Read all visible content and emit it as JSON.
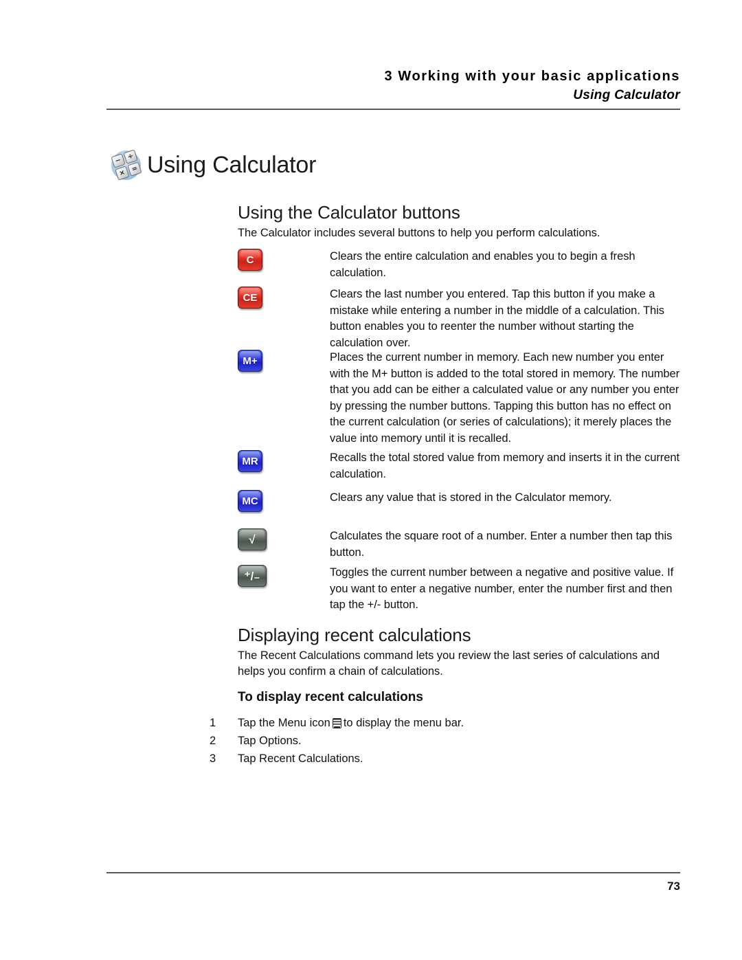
{
  "header": {
    "chapter": "3 Working with your basic applications",
    "section": "Using Calculator"
  },
  "title": {
    "text": "Using Calculator",
    "icon": "calculator-icon",
    "icon_keys": [
      "−",
      "÷",
      "×",
      "="
    ]
  },
  "section_buttons": {
    "heading": "Using the Calculator buttons",
    "intro": "The Calculator includes several buttons to help you perform calculations.",
    "rows": [
      {
        "key_label": "C",
        "key_name": "clear-button",
        "key_color": "#e32b20",
        "description": "Clears the entire calculation and enables you to begin a fresh calculation."
      },
      {
        "key_label": "CE",
        "key_name": "clear-entry-button",
        "key_color": "#e32b20",
        "description": "Clears the last number you entered. Tap this button if you make a mistake while entering a number in the middle of a calculation. This button enables you to reenter the number without starting the calculation over."
      },
      {
        "key_label": "M+",
        "key_name": "memory-add-button",
        "key_color": "#2a2fd8",
        "description": "Places the current number in memory. Each new number you enter with the M+ button is added to the total stored in memory. The number that you add can be either a calculated value or any number you enter by pressing the number buttons. Tapping this button has no effect on the current calculation (or series of calculations); it merely places the value into memory until it is recalled."
      },
      {
        "key_label": "MR",
        "key_name": "memory-recall-button",
        "key_color": "#2a2fd8",
        "description": "Recalls the total stored value from memory and inserts it in the current calculation."
      },
      {
        "key_label": "MC",
        "key_name": "memory-clear-button",
        "key_color": "#2a2fd8",
        "description": "Clears any value that is stored in the Calculator memory."
      },
      {
        "key_label": "√",
        "key_name": "square-root-button",
        "key_color": "#5e6a62",
        "description": "Calculates the square root of a number. Enter a number then tap this button."
      },
      {
        "key_label": "⁺/₋",
        "key_name": "sign-toggle-button",
        "key_color": "#5e6a62",
        "description": "Toggles the current number between a negative and positive value. If you want to enter a negative number, enter the number first and then tap the +/- button."
      }
    ]
  },
  "section_recent": {
    "heading": "Displaying recent calculations",
    "intro": "The Recent Calculations command lets you review the last series of calculations and helps you confirm a chain of calculations.",
    "subheading": "To display recent calculations",
    "steps": [
      {
        "num": "1",
        "before": "Tap the Menu icon",
        "icon": "menu-icon",
        "after": "to display the menu bar."
      },
      {
        "num": "2",
        "before": "Tap Options.",
        "icon": "",
        "after": ""
      },
      {
        "num": "3",
        "before": "Tap Recent Calculations.",
        "icon": "",
        "after": ""
      }
    ]
  },
  "footer": {
    "page_number": "73"
  }
}
